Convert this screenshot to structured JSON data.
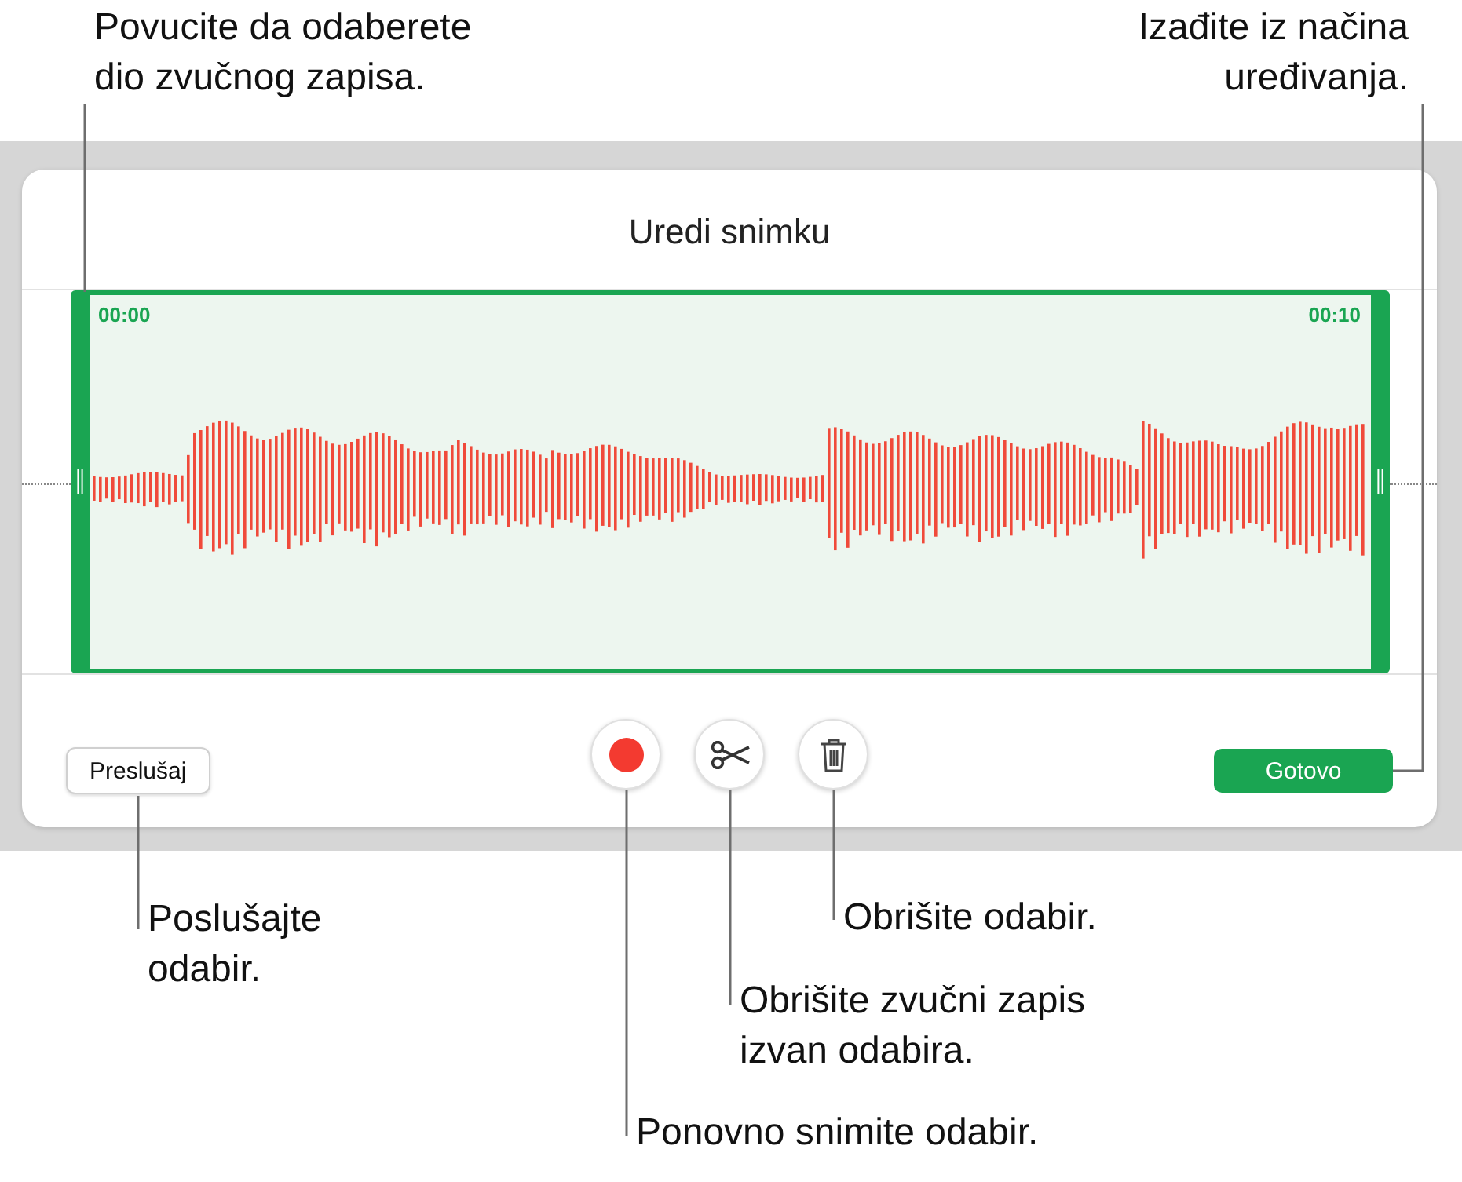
{
  "dialog": {
    "title": "Uredi snimku",
    "start_time": "00:00",
    "end_time": "00:10",
    "play_button": "Preslušaj",
    "done_button": "Gotovo",
    "tools": [
      {
        "kind": "record"
      },
      {
        "kind": "trim"
      },
      {
        "kind": "delete"
      }
    ]
  },
  "callouts": [
    {
      "lines": [
        "Povucite da odaberete",
        "dio zvučnog zapisa."
      ]
    },
    {
      "lines": [
        "Izađite iz načina",
        "uređivanja."
      ]
    },
    {
      "lines": [
        "Poslušajte",
        "odabir."
      ]
    },
    {
      "lines": [
        "Obrišite odabir."
      ]
    },
    {
      "lines": [
        "Obrišite zvučni zapis",
        "izvan odabira."
      ]
    },
    {
      "lines": [
        "Ponovno snimite odabir."
      ]
    }
  ]
}
